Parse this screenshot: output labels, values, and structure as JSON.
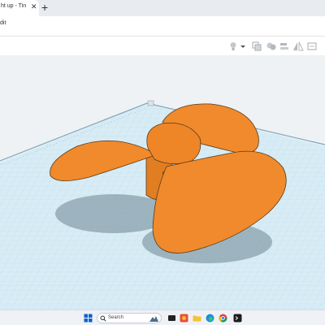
{
  "browser": {
    "tab_title": "ht up - Tin",
    "tab_close": "✕",
    "new_tab": "+"
  },
  "menu": {
    "edit_label": "dit"
  },
  "toolbar": {
    "icons": [
      "lightbulb-icon",
      "dropdown-caret-icon",
      "group-icon",
      "ungroup-icon",
      "align-icon",
      "mirror-icon",
      "cruise-icon"
    ]
  },
  "taskbar": {
    "search_placeholder": "Search",
    "icons": [
      "windows-start-icon",
      "search-icon",
      "mountain-widget-icon",
      "file-explorer-icon",
      "photos-icon",
      "edge-icon",
      "chrome-icon",
      "terminal-icon"
    ]
  },
  "colors": {
    "model_orange": "#f08a2c",
    "model_outline": "#5a3a1a",
    "grid_blue": "#c9e6f2",
    "workplane_bg": "#eef2f5"
  }
}
